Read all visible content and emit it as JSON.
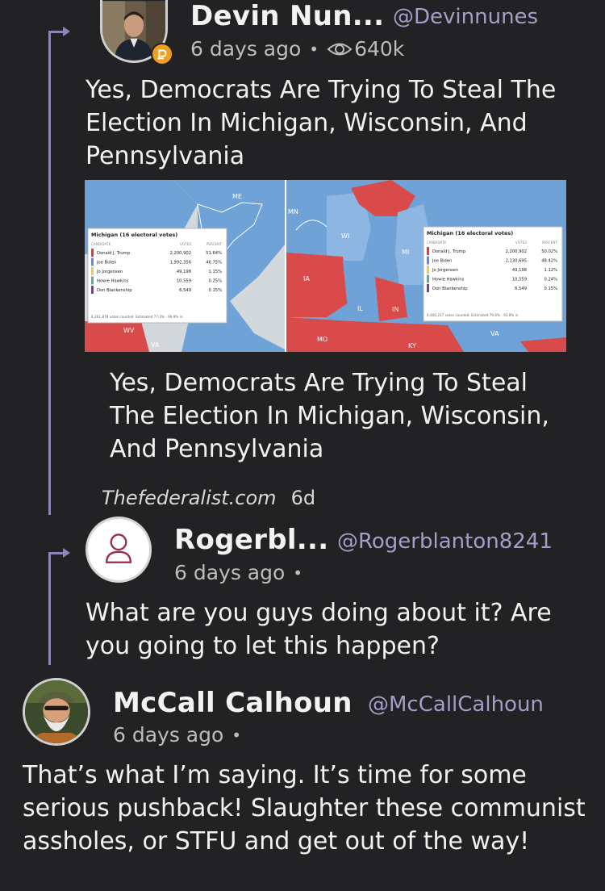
{
  "post1": {
    "name": "Devin Nun...",
    "handle": "@Devinnunes",
    "time": "6 days ago",
    "views": "640k",
    "text": "Yes, Democrats Are Trying To Steal The Election In Michigan, Wisconsin, And Pennsylvania",
    "card": {
      "title": "Yes, Democrats Are Trying To Steal The Election In Michigan, Wisconsin, And Pennsylvania",
      "source": "Thefederalist.com",
      "age": "6d",
      "map_labels": [
        "ME",
        "MN",
        "WI",
        "MI",
        "IA",
        "IL",
        "IN",
        "MO",
        "KY",
        "WV",
        "VA",
        "VA"
      ],
      "results_left": {
        "title": "Michigan (16 electoral votes)",
        "header": [
          "CANDIDATE",
          "VOTES",
          "PERCENT"
        ],
        "rows": [
          [
            "Donald J. Trump",
            "2,200,902",
            "51.64%"
          ],
          [
            "Joe Biden",
            "1,992,356",
            "46.75%"
          ],
          [
            "Jo Jorgensen",
            "49,198",
            "1.15%"
          ],
          [
            "Howie Hawkins",
            "10,559",
            "0.25%"
          ],
          [
            "Don Blankenship",
            "6,549",
            "0.15%"
          ]
        ],
        "footer": "4,261,878 votes counted. Estimated 77.3% - 99.9% in"
      },
      "results_right": {
        "title": "Michigan (16 electoral votes)",
        "header": [
          "CANDIDATE",
          "VOTES",
          "PERCENT"
        ],
        "rows": [
          [
            "Donald J. Trump",
            "2,200,902",
            "50.02%"
          ],
          [
            "Joe Biden",
            "2,130,695",
            "48.42%"
          ],
          [
            "Jo Jorgensen",
            "49,198",
            "1.12%"
          ],
          [
            "Howie Hawkins",
            "10,559",
            "0.24%"
          ],
          [
            "Don Blankenship",
            "6,549",
            "0.15%"
          ]
        ],
        "footer": "4,400,217 votes counted. Estimated 79.8% - 93.8% in"
      }
    }
  },
  "post2": {
    "name": "Rogerbl...",
    "handle": "@Rogerblanton8241",
    "time": "6 days ago",
    "text": "What are you guys doing about it? Are you going to let this happen?"
  },
  "post3": {
    "name": "McCall Calhoun",
    "handle": "@McCallCalhoun",
    "time": "6 days ago",
    "text": "That’s what I’m saying. It’s time for some serious pushback! Slaughter these communist assholes, or STFU and get out of the way!"
  },
  "colors": {
    "background": "#222124",
    "thread": "#8d87b8",
    "handle": "#a49ec9",
    "republican": "#d94b4b",
    "democrat": "#6fa3d8",
    "badge": "#f0a020",
    "candidate_colors": [
      "#e03c3c",
      "#5b8fd9",
      "#f2c94c",
      "#4fb59a",
      "#7b3fa0"
    ]
  }
}
